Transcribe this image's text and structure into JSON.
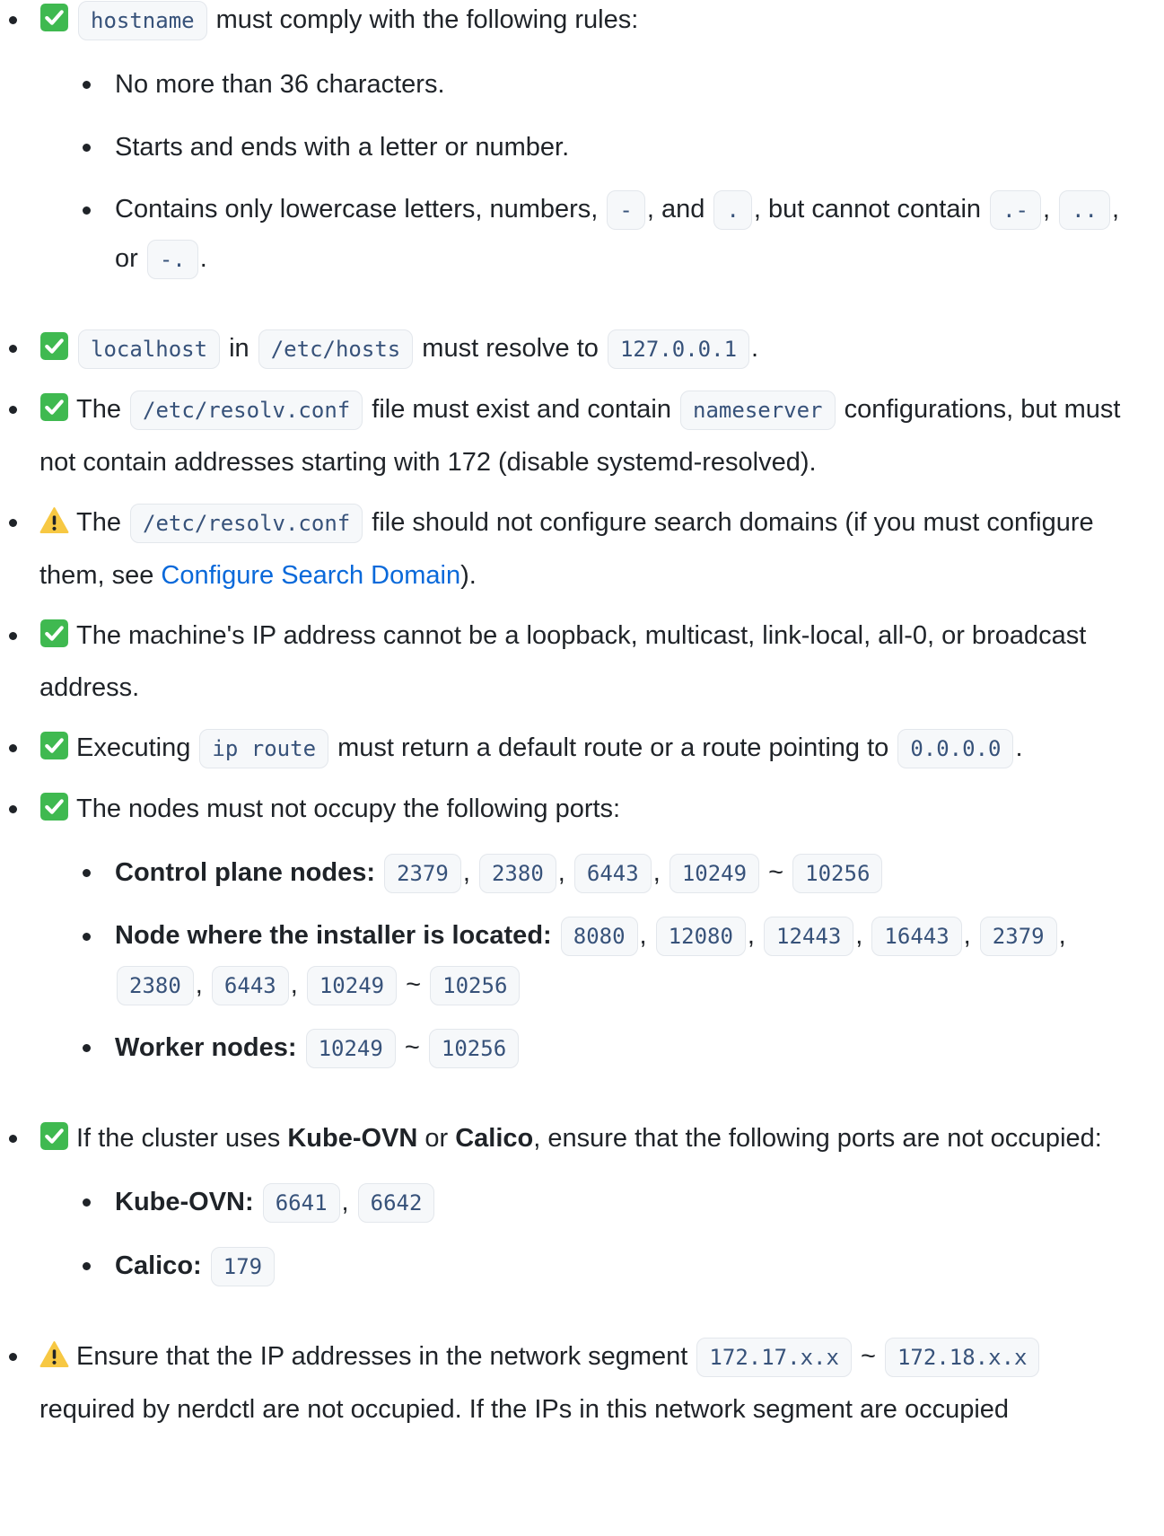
{
  "items": [
    {
      "icon": "check-icon",
      "code": "hostname",
      "text": " must comply with the following rules:",
      "rules": [
        "No more than 36 characters.",
        "Starts and ends with a letter or number."
      ],
      "rule3": {
        "text1": "Contains only lowercase letters, numbers, ",
        "code1": "-",
        "text2": ", and ",
        "code2": ".",
        "text3": ", but cannot contain ",
        "code3": ".-",
        "sep1": ", ",
        "code4": "..",
        "sep2": ", or ",
        "code5": "-.",
        "end": "."
      }
    },
    {
      "icon": "check-icon",
      "code1": "localhost",
      "text1": " in ",
      "code2": "/etc/hosts",
      "text2": " must resolve to ",
      "code3": "127.0.0.1",
      "end": "."
    },
    {
      "icon": "check-icon",
      "text1": "The ",
      "code1": "/etc/resolv.conf",
      "text2": " file must exist and contain ",
      "code2": "nameserver",
      "text3": " configurations, but must not contain addresses starting with 172 (disable systemd-resolved)."
    },
    {
      "icon": "warning-icon",
      "text1": "The ",
      "code1": "/etc/resolv.conf",
      "text2": " file should not configure search domains (if you must configure them, see ",
      "link": "Configure Search Domain",
      "text3": ")."
    },
    {
      "icon": "check-icon",
      "text": "The machine's IP address cannot be a loopback, multicast, link-local, all-0, or broadcast address."
    },
    {
      "icon": "check-icon",
      "text1": "Executing ",
      "code1": "ip route",
      "text2": " must return a default route or a route pointing to ",
      "code2": "0.0.0.0",
      "end": "."
    },
    {
      "icon": "check-icon",
      "text": "The nodes must not occupy the following ports:",
      "control_plane": {
        "label": "Control plane nodes:",
        "ports": [
          "2379",
          "2380",
          "6443",
          "10249",
          "10256"
        ]
      },
      "installer": {
        "label": "Node where the installer is located:",
        "ports": [
          "8080",
          "12080",
          "12443",
          "16443",
          "2379",
          "2380",
          "6443",
          "10249",
          "10256"
        ]
      },
      "worker": {
        "label": "Worker nodes:",
        "ports": [
          "10249",
          "10256"
        ]
      }
    },
    {
      "icon": "check-icon",
      "text1": "If the cluster uses ",
      "bold1": "Kube-OVN",
      "text2": " or ",
      "bold2": "Calico",
      "text3": ", ensure that the following ports are not occupied:",
      "kube_ovn": {
        "label": "Kube-OVN:",
        "ports": [
          "6641",
          "6642"
        ]
      },
      "calico": {
        "label": "Calico:",
        "ports": [
          "179"
        ]
      }
    },
    {
      "icon": "warning-icon",
      "text1": "Ensure that the IP addresses in the network segment ",
      "code1": "172.17.x.x",
      "sep": " ~ ",
      "code2": "172.18.x.x",
      "text2": " required by nerdctl are not occupied. If the IPs in this network segment are occupied"
    }
  ],
  "separators": {
    "comma": ", ",
    "tilde": " ~ "
  },
  "colors": {
    "text": "#1f2328",
    "code_text": "#37527a",
    "code_bg": "#f6f8fa",
    "link": "#0969da",
    "check_green": "#3fb950",
    "warning_yellow": "#f7c843"
  }
}
